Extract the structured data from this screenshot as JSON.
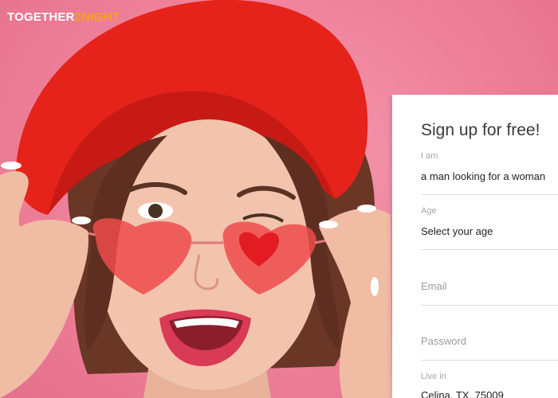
{
  "brand": {
    "part1": "TOGETHER",
    "part2": "2NIGHT"
  },
  "signup": {
    "title": "Sign up for free!",
    "iam": {
      "label": "I am",
      "value": "a man looking for a woman"
    },
    "age": {
      "label": "Age",
      "value": "Select your age"
    },
    "email": {
      "placeholder": "Email"
    },
    "password": {
      "placeholder": "Password"
    },
    "live_in": {
      "label": "Live in",
      "value": "Celina, TX, 75009"
    }
  },
  "colors": {
    "accent": "#f7a21b",
    "background": "#ee8099",
    "hat": "#e5231b",
    "card": "#ffffff"
  }
}
